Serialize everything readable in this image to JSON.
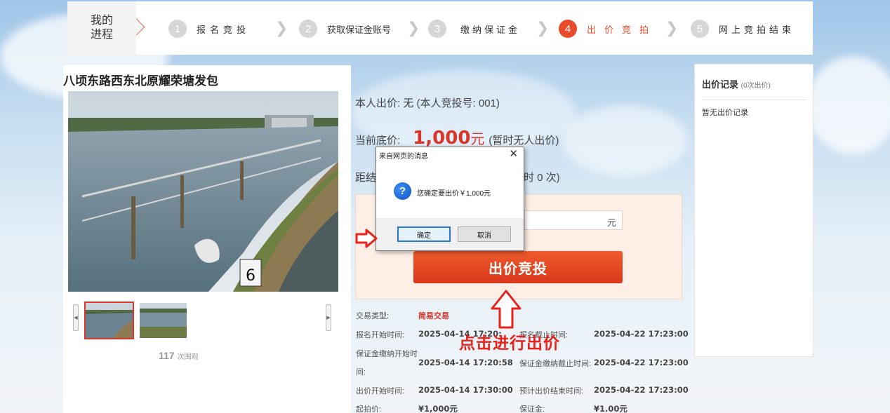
{
  "progress": {
    "title": "我的\n进程",
    "steps": [
      {
        "num": "1",
        "label": "报名竞投"
      },
      {
        "num": "2",
        "label": "获取保证金账号"
      },
      {
        "num": "3",
        "label": "缴纳保证金"
      },
      {
        "num": "4",
        "label": "出价竞拍"
      },
      {
        "num": "5",
        "label": "网上竞拍结束"
      }
    ],
    "active_color": "#e84a2a"
  },
  "lot": {
    "title": "八顷东路西东北原耀荣塘发包",
    "photo_marker": "6",
    "views_count": "117",
    "views_suffix": "次围观"
  },
  "bid_status": {
    "my_bid_label": "本人出价:",
    "my_bid_value": "无",
    "my_bid_no": "(本人竞投号: 001)",
    "floor_label": "当前底价:",
    "floor_amount": "1,000",
    "floor_unit": "元",
    "floor_note": "(暂时无人出价)",
    "countdown_prefix": "距结",
    "countdown_suffix": "时 0 次)",
    "input_unit": "元",
    "bid_button": "出价竞投"
  },
  "details": {
    "type_label": "交易类型:",
    "type_value": "简易交易",
    "reg_start_label": "报名开始时间:",
    "reg_start_value": "2025-04-14 17:20:",
    "reg_end_label": "报名截止时间:",
    "reg_end_value": "2025-04-22 17:23:00",
    "dep_start_label_1": "保证金缴纳开始时",
    "dep_start_label_2": "间:",
    "dep_start_value": "2025-04-14 17:20:58",
    "dep_end_label": "保证金缴纳截止时间:",
    "dep_end_value": "2025-04-22 17:23:00",
    "bid_start_label": "出价开始时间:",
    "bid_start_value": "2025-04-14 17:30:00",
    "bid_end_label": "预计出价结束时间:",
    "bid_end_value": "2025-04-22 17:23:00",
    "start_price_label": "起拍价:",
    "start_price_value": "¥1,000元",
    "deposit_label": "保证金:",
    "deposit_value": "¥1.00元"
  },
  "records": {
    "title": "出价记录",
    "count": "(0次出价)",
    "empty": "暂无出价记录"
  },
  "dialog": {
    "title": "来自网页的消息",
    "close": "✕",
    "message": "您确定要出价￥1,000元",
    "ok": "确定",
    "cancel": "取消"
  },
  "annotation": {
    "text": "点击进行出价",
    "color": "#e8221a"
  }
}
